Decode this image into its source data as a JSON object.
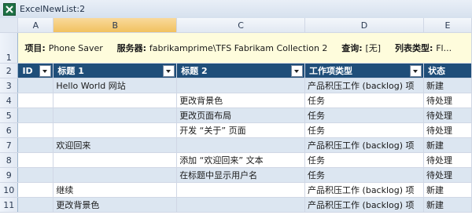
{
  "window": {
    "title": "ExcelNewList:2"
  },
  "columns": [
    "A",
    "B",
    "C",
    "D",
    "E"
  ],
  "info": {
    "project_label": "项目:",
    "project_value": "Phone Saver",
    "server_label": "服务器:",
    "server_value": "fabrikamprime\\TFS Fabrikam Collection 2",
    "query_label": "查询:",
    "query_value": "[无]",
    "list_type_label": "列表类型:",
    "list_type_value": "Fl..."
  },
  "headers": [
    "ID",
    "标题 1",
    "标题 2",
    "工作项类型",
    "状态"
  ],
  "rows": [
    {
      "num": "3",
      "id": "",
      "t1": "Hello World 网站",
      "t2": "",
      "type": "产品积压工作 (backlog) 项",
      "state": "新建"
    },
    {
      "num": "4",
      "id": "",
      "t1": "",
      "t2": "更改背景色",
      "type": "任务",
      "state": "待处理"
    },
    {
      "num": "5",
      "id": "",
      "t1": "",
      "t2": "更改页面布局",
      "type": "任务",
      "state": "待处理"
    },
    {
      "num": "6",
      "id": "",
      "t1": "",
      "t2": "开发 “关于” 页面",
      "type": "任务",
      "state": "待处理"
    },
    {
      "num": "7",
      "id": "",
      "t1": "欢迎回来",
      "t2": "",
      "type": "产品积压工作 (backlog) 项",
      "state": "新建"
    },
    {
      "num": "8",
      "id": "",
      "t1": "",
      "t2": "添加 “欢迎回来” 文本",
      "type": "任务",
      "state": "待处理"
    },
    {
      "num": "9",
      "id": "",
      "t1": "",
      "t2": "在标题中显示用户名",
      "type": "任务",
      "state": "待处理"
    },
    {
      "num": "10",
      "id": "",
      "t1": "继续",
      "t2": "",
      "type": "产品积压工作 (backlog) 项",
      "state": "新建"
    },
    {
      "num": "11",
      "id": "",
      "t1": "更改背景色",
      "t2": "",
      "type": "产品积压工作 (backlog) 项",
      "state": "新建"
    }
  ],
  "row_numbers": {
    "info": "1",
    "header": "2"
  },
  "colors": {
    "header_bg": "#1f4e79",
    "band_bg": "#dce6f1",
    "info_bg": "#fefcdc",
    "selected_col": "#f1c15f"
  }
}
